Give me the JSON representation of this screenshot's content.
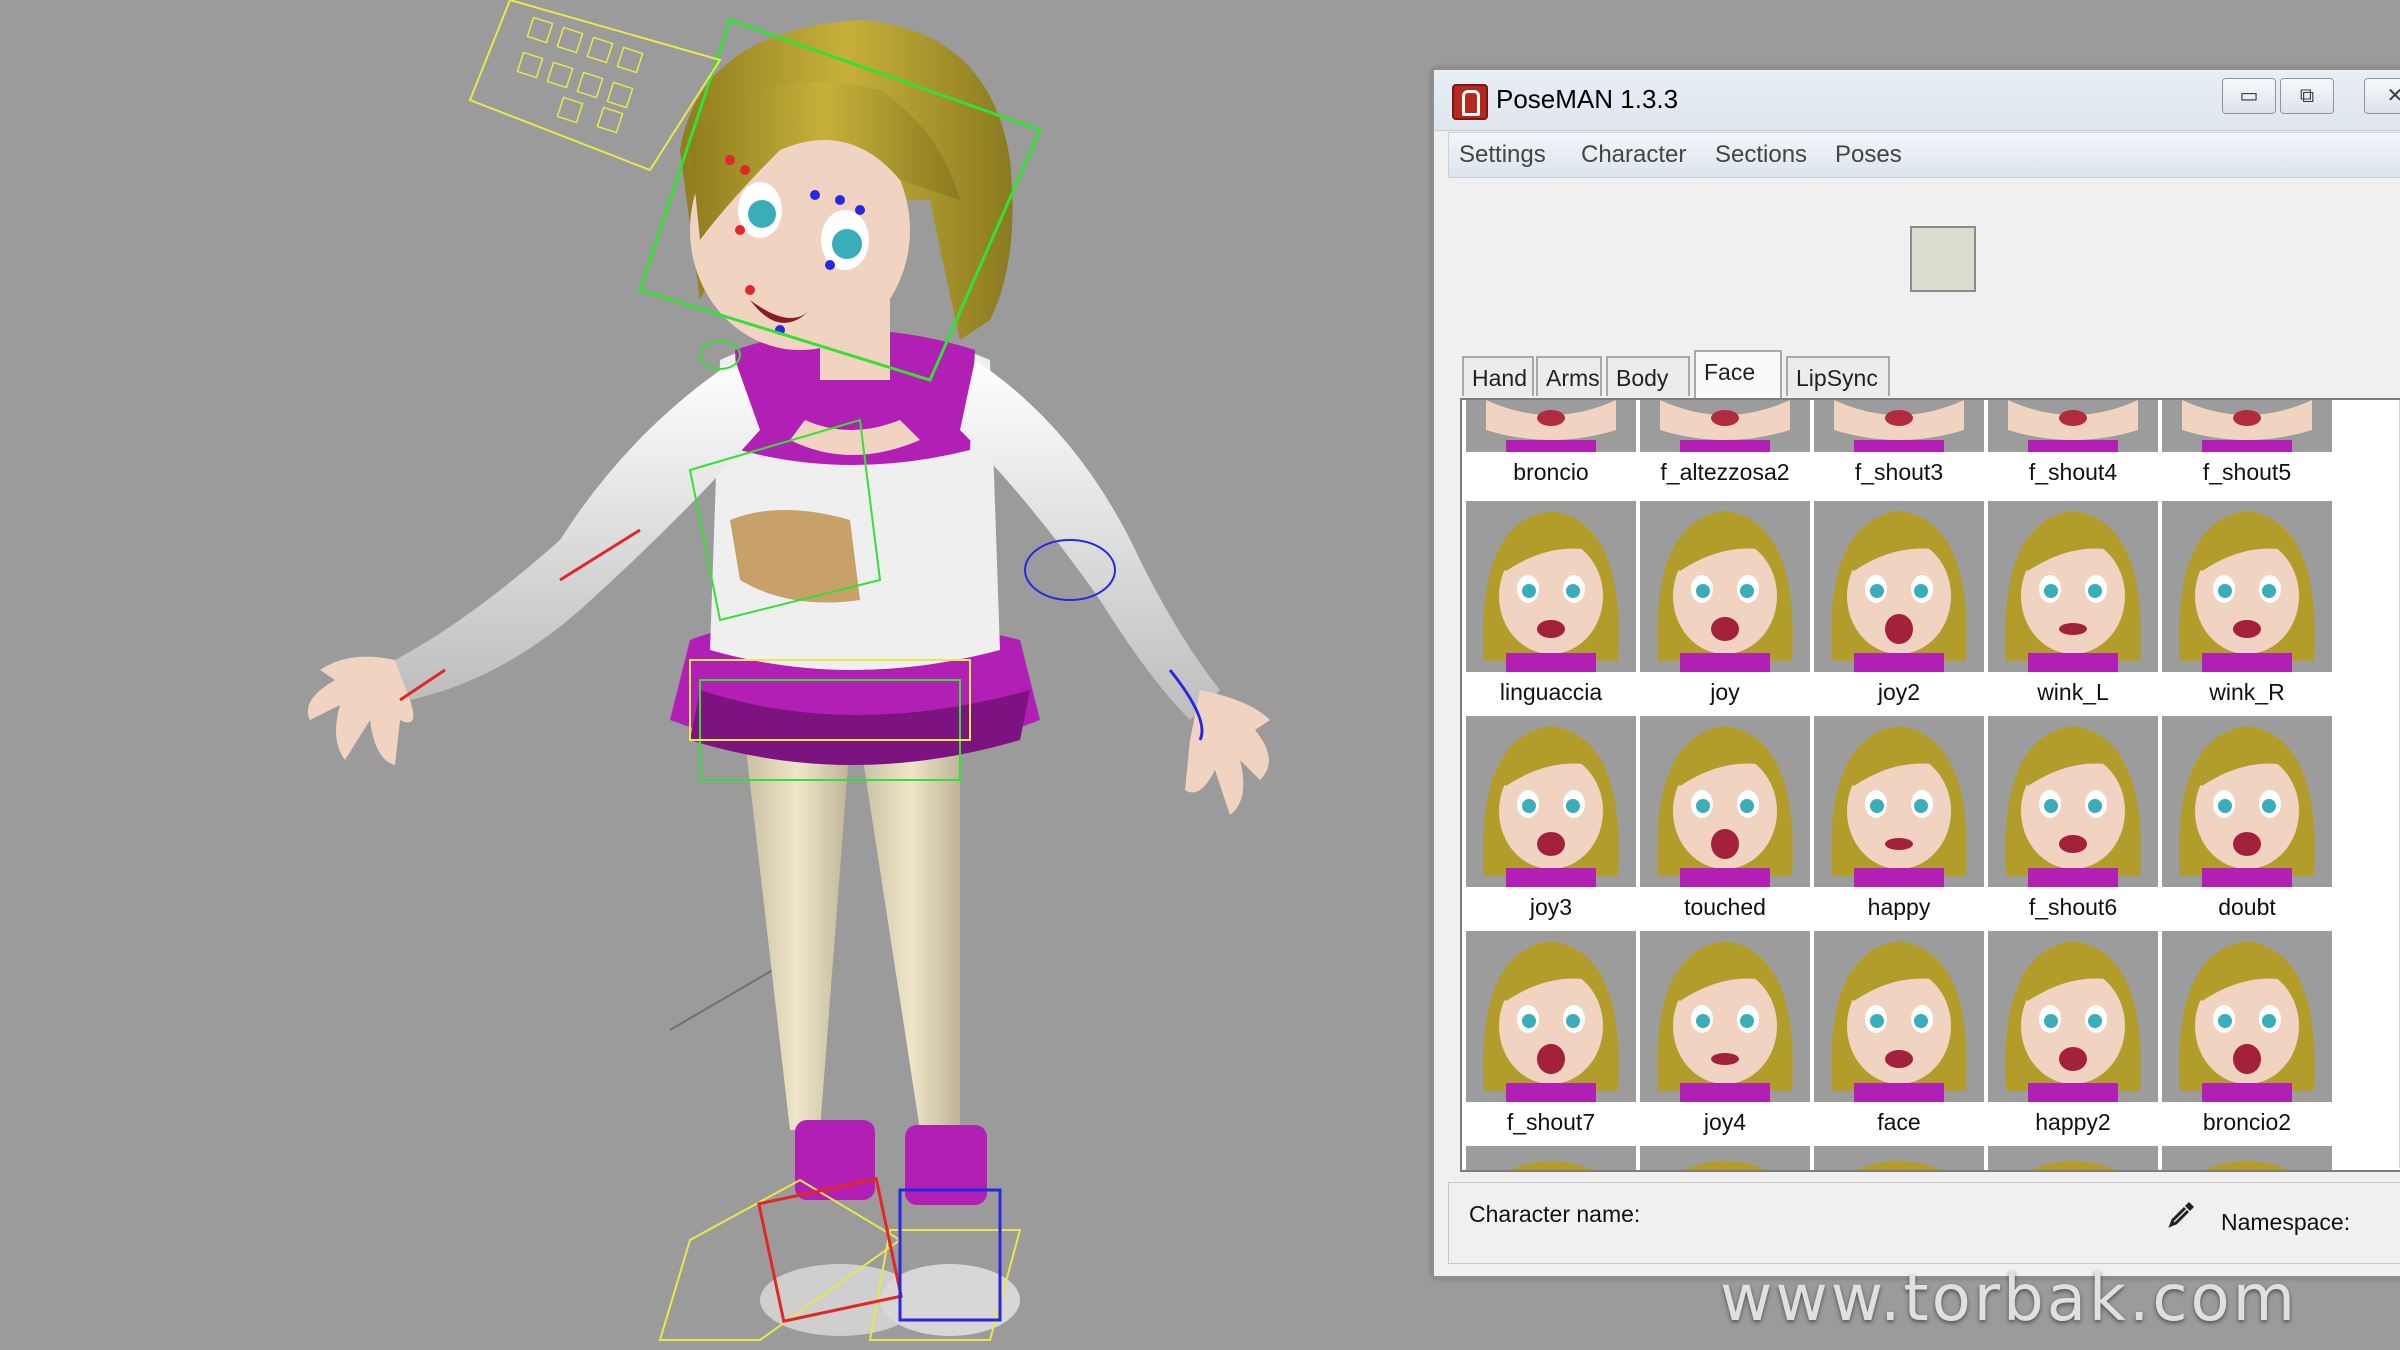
{
  "window": {
    "title": "PoseMAN 1.3.3",
    "controls": {
      "minimize": "▭",
      "maximize": "⧉",
      "close": "✕"
    }
  },
  "menu": [
    "Settings",
    "Character",
    "Sections",
    "Poses"
  ],
  "tabs": [
    {
      "label": "Hand",
      "active": false
    },
    {
      "label": "Arms",
      "active": false
    },
    {
      "label": "Body",
      "active": false
    },
    {
      "label": "Face",
      "active": true
    },
    {
      "label": "LipSync",
      "active": false
    }
  ],
  "poses": [
    "broncio",
    "f_altezzosa2",
    "f_shout3",
    "f_shout4",
    "f_shout5",
    "linguaccia",
    "joy",
    "joy2",
    "wink_L",
    "wink_R",
    "joy3",
    "touched",
    "happy",
    "f_shout6",
    "doubt",
    "f_shout7",
    "joy4",
    "face",
    "happy2",
    "broncio2"
  ],
  "footer": {
    "character_name_label": "Character name:",
    "namespace_label": "Namespace:"
  },
  "watermark": "www.torbak.com",
  "colors": {
    "viewport_bg": "#9b9b9b",
    "hair": "#b39d2a",
    "outfit_magenta": "#b11fb4",
    "skin": "#f1d3c2",
    "control_green": "#33e033",
    "control_yellow": "#e8e84a"
  },
  "icons": {
    "app": "poseman-app-icon",
    "picker": "eyedropper-icon"
  }
}
